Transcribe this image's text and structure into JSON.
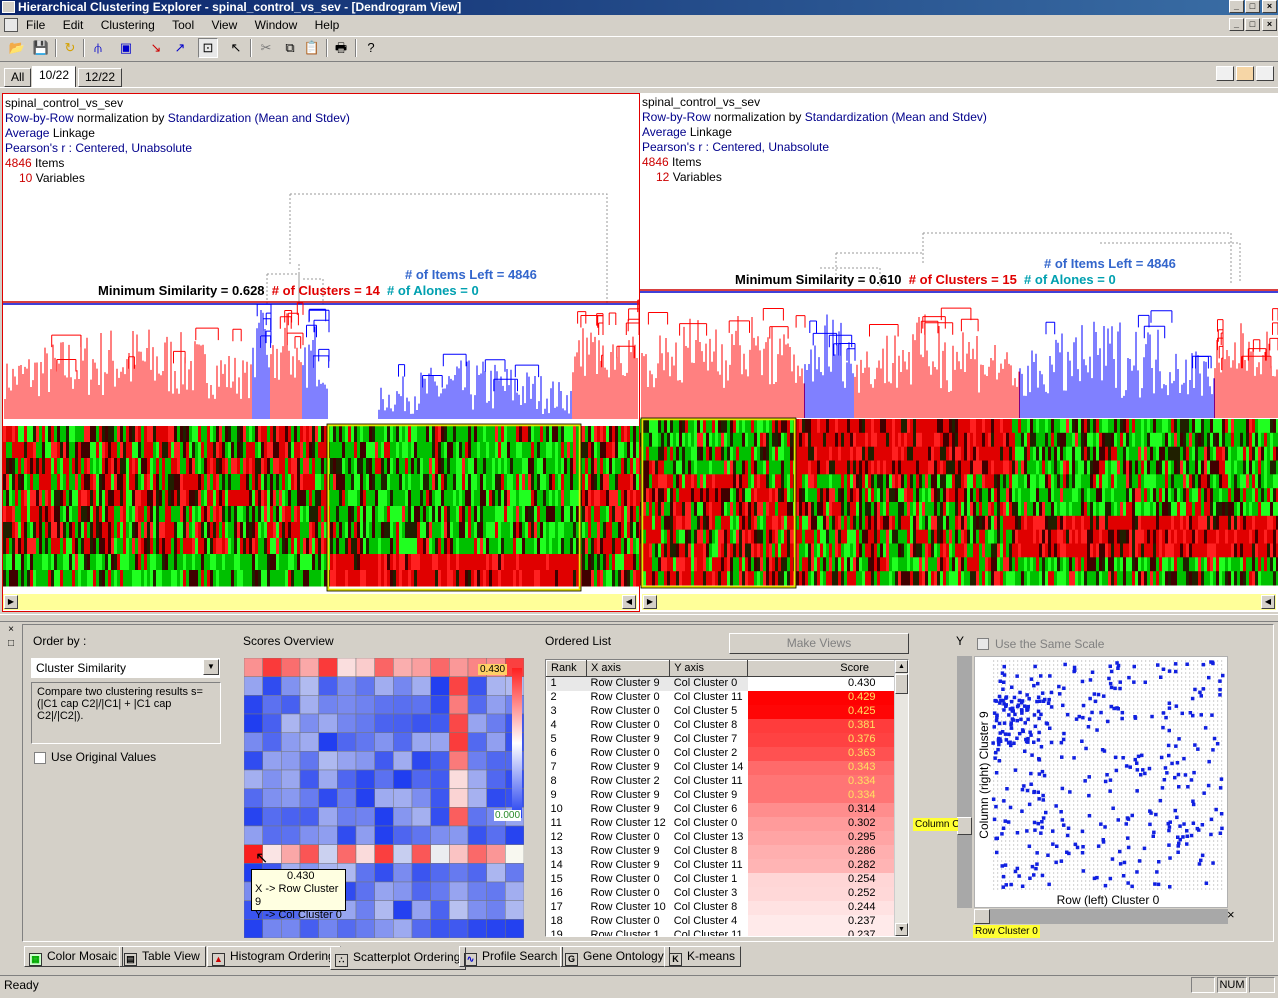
{
  "window": {
    "title": "Hierarchical Clustering Explorer - spinal_control_vs_sev - [Dendrogram View]"
  },
  "menu": [
    "File",
    "Edit",
    "Clustering",
    "Tool",
    "View",
    "Window",
    "Help"
  ],
  "tabs": [
    "All",
    "10/22",
    "12/22"
  ],
  "left_panel": {
    "dataset": "spinal_control_vs_sev",
    "norm_a": "Row-by-Row",
    "norm_b": "normalization by",
    "norm_c": "Standardization (Mean and Stdev)",
    "linkage_a": "Average",
    "linkage_b": "Linkage",
    "similarity": "Pearson's r : Centered, Unabsolute",
    "items_count": "4846",
    "items_label": "Items",
    "vars_count": "10",
    "vars_label": "Variables",
    "min_sim": "Minimum Similarity = 0.628",
    "clusters": "# of Clusters = 14",
    "items_left": "# of Items Left = 4846",
    "alones": "# of Alones = 0"
  },
  "right_panel": {
    "dataset": "spinal_control_vs_sev",
    "norm_a": "Row-by-Row",
    "norm_b": "normalization by",
    "norm_c": "Standardization (Mean and Stdev)",
    "linkage_a": "Average",
    "linkage_b": "Linkage",
    "similarity": "Pearson's r : Centered, Unabsolute",
    "items_count": "4846",
    "items_label": "Items",
    "vars_count": "12",
    "vars_label": "Variables",
    "min_sim": "Minimum Similarity = 0.610",
    "clusters": "# of Clusters = 15",
    "items_left": "# of Items Left = 4846",
    "alones": "# of Alones = 0"
  },
  "order_by": {
    "label": "Order by :",
    "selected": "Cluster Similarity",
    "description": "Compare two clustering results s=(|C1 cap C2|/|C1| + |C1 cap C2|/|C2|).",
    "use_original": "Use Original Values"
  },
  "scores_overview": {
    "label": "Scores Overview",
    "max_label": "0.430",
    "min_label": "0.000",
    "tooltip": {
      "value": "0.430",
      "x": "X -> Row Cluster 9",
      "y": "Y -> Col Cluster 0"
    }
  },
  "ordered_list": {
    "label": "Ordered List",
    "make_views": "Make Views",
    "headers": [
      "Rank",
      "X axis",
      "Y axis",
      "Score"
    ],
    "rows": [
      {
        "rank": "1",
        "x": "Row Cluster 9",
        "y": "Col Cluster 0",
        "score": "0.430"
      },
      {
        "rank": "2",
        "x": "Row Cluster 0",
        "y": "Col Cluster 11",
        "score": "0.429"
      },
      {
        "rank": "3",
        "x": "Row Cluster 0",
        "y": "Col Cluster 5",
        "score": "0.425"
      },
      {
        "rank": "4",
        "x": "Row Cluster 0",
        "y": "Col Cluster 8",
        "score": "0.381"
      },
      {
        "rank": "5",
        "x": "Row Cluster 9",
        "y": "Col Cluster 7",
        "score": "0.376"
      },
      {
        "rank": "6",
        "x": "Row Cluster 0",
        "y": "Col Cluster 2",
        "score": "0.363"
      },
      {
        "rank": "7",
        "x": "Row Cluster 9",
        "y": "Col Cluster 14",
        "score": "0.343"
      },
      {
        "rank": "8",
        "x": "Row Cluster 2",
        "y": "Col Cluster 11",
        "score": "0.334"
      },
      {
        "rank": "9",
        "x": "Row Cluster 9",
        "y": "Col Cluster 9",
        "score": "0.334"
      },
      {
        "rank": "10",
        "x": "Row Cluster 9",
        "y": "Col Cluster 6",
        "score": "0.314"
      },
      {
        "rank": "11",
        "x": "Row Cluster 12",
        "y": "Col Cluster 0",
        "score": "0.302"
      },
      {
        "rank": "12",
        "x": "Row Cluster 0",
        "y": "Col Cluster 13",
        "score": "0.295"
      },
      {
        "rank": "13",
        "x": "Row Cluster 9",
        "y": "Col Cluster 8",
        "score": "0.286"
      },
      {
        "rank": "14",
        "x": "Row Cluster 9",
        "y": "Col Cluster 11",
        "score": "0.282"
      },
      {
        "rank": "15",
        "x": "Row Cluster 0",
        "y": "Col Cluster 1",
        "score": "0.254"
      },
      {
        "rank": "16",
        "x": "Row Cluster 0",
        "y": "Col Cluster 3",
        "score": "0.252"
      },
      {
        "rank": "17",
        "x": "Row Cluster 10",
        "y": "Col Cluster 8",
        "score": "0.244"
      },
      {
        "rank": "18",
        "x": "Row Cluster 0",
        "y": "Col Cluster 4",
        "score": "0.237"
      },
      {
        "rank": "19",
        "x": "Row Cluster 1",
        "y": "Col Cluster 11",
        "score": "0.237"
      }
    ]
  },
  "scatter": {
    "y_label": "Y",
    "same_scale": "Use the Same Scale",
    "axis_y": "Column (right) Cluster 9",
    "axis_x": "Row (left) Cluster 0",
    "col_slider": "Column C",
    "row_slider": "Row Cluster 0"
  },
  "bottom_tabs": [
    {
      "label": "Color Mosaic",
      "icon": "▦"
    },
    {
      "label": "Table View",
      "icon": "▤"
    },
    {
      "label": "Histogram Ordering",
      "icon": "▲"
    },
    {
      "label": "Scatterplot Ordering",
      "icon": "∴"
    },
    {
      "label": "Profile Search",
      "icon": "∿"
    },
    {
      "label": "Gene Ontology",
      "icon": "G"
    },
    {
      "label": "K-means",
      "icon": "K"
    }
  ],
  "status": {
    "text": "Ready",
    "num": "NUM"
  },
  "colors": {
    "title_bar": "#0a246a",
    "cluster_red": "#ff0000",
    "cluster_blue": "#0000ff",
    "selection": "#ffff00",
    "heat_green": "#00ff00"
  }
}
